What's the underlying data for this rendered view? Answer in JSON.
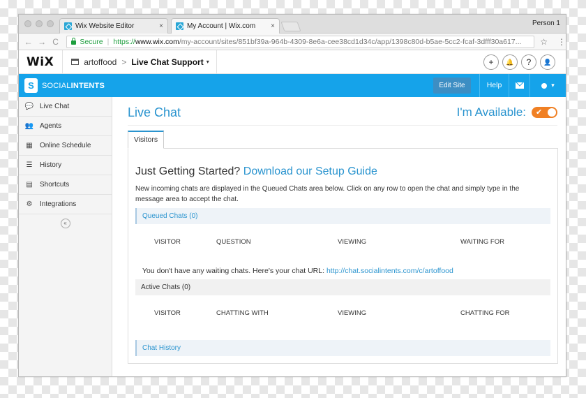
{
  "browser": {
    "tabs": [
      {
        "title": "Wix Website Editor",
        "close": "×"
      },
      {
        "title": "My Account | Wix.com",
        "close": "×"
      }
    ],
    "profile": "Person 1",
    "nav": {
      "back": "←",
      "forward": "→",
      "reload": "C"
    },
    "secure_label": "Secure",
    "url_scheme": "https://",
    "url_host": "www.wix.com",
    "url_path": "/my-account/sites/851bf39a-964b-4309-8e6a-cee38cd1d34c/app/1398c80d-b5ae-5cc2-fcaf-3dfff30a617...",
    "star": "☆",
    "menu": "⋮"
  },
  "wix": {
    "logo": "WiX",
    "site_name": "artoffood",
    "breadcrumb_sep": ">",
    "app_name": "Live Chat Support",
    "caret": "▾",
    "buttons": {
      "add": "+",
      "notify": "🔔",
      "help": "?",
      "account": "👤"
    }
  },
  "header": {
    "logo_glyph": "S",
    "brand_light": "SOCIAL",
    "brand_bold": "INTENTS",
    "edit_site": "Edit Site",
    "help": "Help",
    "user_caret": "▾",
    "accent": "#15a3ea"
  },
  "sidebar": {
    "items": [
      {
        "label": "Live Chat",
        "icon": "chat-bubbles-icon",
        "glyph": "💬"
      },
      {
        "label": "Agents",
        "icon": "users-icon",
        "glyph": "👥"
      },
      {
        "label": "Online Schedule",
        "icon": "calendar-icon",
        "glyph": "▦"
      },
      {
        "label": "History",
        "icon": "list-icon",
        "glyph": "☰"
      },
      {
        "label": "Shortcuts",
        "icon": "document-icon",
        "glyph": "▤"
      },
      {
        "label": "Integrations",
        "icon": "gears-icon",
        "glyph": "⚙"
      }
    ],
    "collapse": "«"
  },
  "main": {
    "title": "Live Chat",
    "availability_label": "I'm Available:",
    "toggle_check": "✔",
    "toggle_color": "#f08024",
    "tab": "Visitors",
    "getting_started": "Just Getting Started?",
    "setup_link": "Download our Setup Guide",
    "description": "New incoming chats are displayed in the Queued Chats area below. Click on any row to open the chat and simply type in the message area to accept the chat.",
    "queued": {
      "title": "Queued Chats (0)",
      "columns": [
        "VISITOR",
        "QUESTION",
        "VIEWING",
        "WAITING FOR"
      ],
      "empty_text": "You don't have any waiting chats. Here's your chat URL:",
      "chat_url": "http://chat.socialintents.com/c/artoffood"
    },
    "active": {
      "title": "Active Chats (0)",
      "columns": [
        "VISITOR",
        "CHATTING WITH",
        "VIEWING",
        "CHATTING FOR"
      ]
    },
    "history": {
      "title": "Chat History"
    }
  }
}
